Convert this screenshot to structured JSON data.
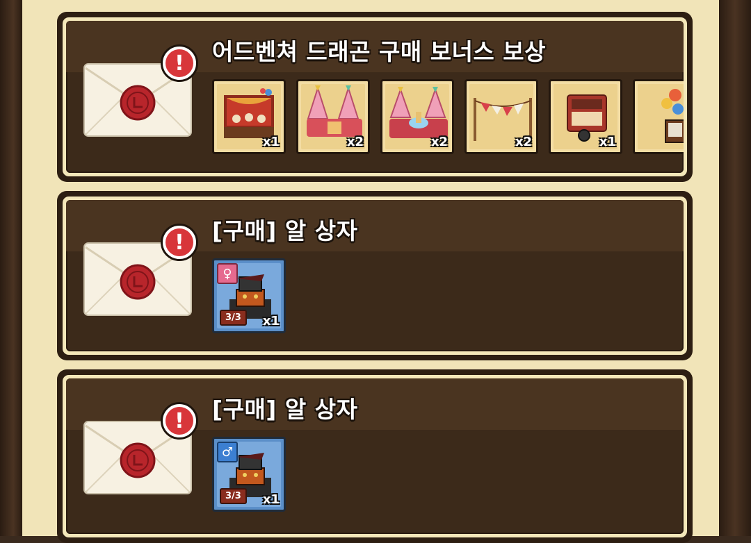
{
  "mail_list": [
    {
      "title": "어드벤쳐 드래곤 구매 보너스 보상",
      "alert_glyph": "!",
      "envelope_icon": "sealed-envelope-icon",
      "rewards": [
        {
          "icon": "stage-decoration-icon",
          "qty": "x1"
        },
        {
          "icon": "pink-trees-decoration-icon",
          "qty": "x2"
        },
        {
          "icon": "pink-trees-fountain-decoration-icon",
          "qty": "x2"
        },
        {
          "icon": "bunting-flags-decoration-icon",
          "qty": "x2"
        },
        {
          "icon": "vending-cart-decoration-icon",
          "qty": "x1"
        },
        {
          "icon": "balloon-sign-decoration-icon",
          "qty": ""
        }
      ]
    },
    {
      "title": "[구매] 알 상자",
      "alert_glyph": "!",
      "envelope_icon": "sealed-envelope-icon",
      "rewards": [
        {
          "icon": "egg-box-icon",
          "gender": "♀",
          "gender_icon": "female-icon",
          "stage": "3/3",
          "qty": "x1"
        }
      ]
    },
    {
      "title": "[구매] 알 상자",
      "alert_glyph": "!",
      "envelope_icon": "sealed-envelope-icon",
      "rewards": [
        {
          "icon": "egg-box-icon",
          "gender": "♂",
          "gender_icon": "male-icon",
          "stage": "3/3",
          "qty": "x1"
        }
      ]
    }
  ],
  "colors": {
    "panel_bg": "#f1e4b8",
    "card_body": "#3c2a1a",
    "alert_red": "#d8363a",
    "seal_red": "#b8252b",
    "female_pink": "#e56a8f",
    "male_blue": "#3c7fd1",
    "egg_tile_blue": "#7aa9dc"
  }
}
